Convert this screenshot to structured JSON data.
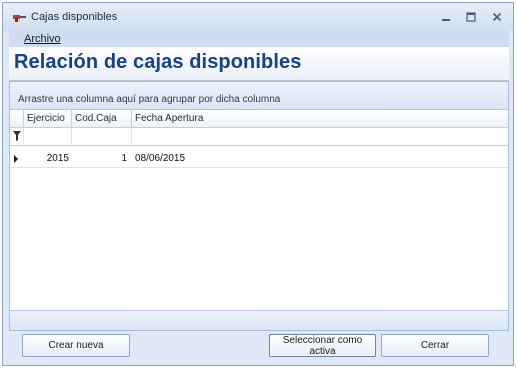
{
  "window": {
    "title": "Cajas disponibles",
    "icons": {
      "app": "drill-icon",
      "minimize": "minimize-icon",
      "maximize": "maximize-icon",
      "close": "close-icon"
    }
  },
  "menu": {
    "items": [
      {
        "label": "Archivo"
      }
    ]
  },
  "header": {
    "title": "Relación de cajas disponibles"
  },
  "grid": {
    "group_hint": "Arrastre una columna aquí para agrupar por dicha columna",
    "columns": [
      {
        "label": "Ejercicio"
      },
      {
        "label": "Cod.Caja"
      },
      {
        "label": "Fecha Apertura"
      }
    ],
    "filter_icon": "filter-icon",
    "rows": [
      {
        "ejercicio": "2015",
        "cod_caja": "1",
        "fecha_apertura": "08/06/2015"
      }
    ]
  },
  "buttons": {
    "crear": "Crear nueva",
    "seleccionar": "Seleccionar como activa",
    "cerrar": "Cerrar"
  },
  "colors": {
    "title_blue": "#15428b",
    "window_bg": "#dfe8f6",
    "border": "#8fa6c2"
  }
}
